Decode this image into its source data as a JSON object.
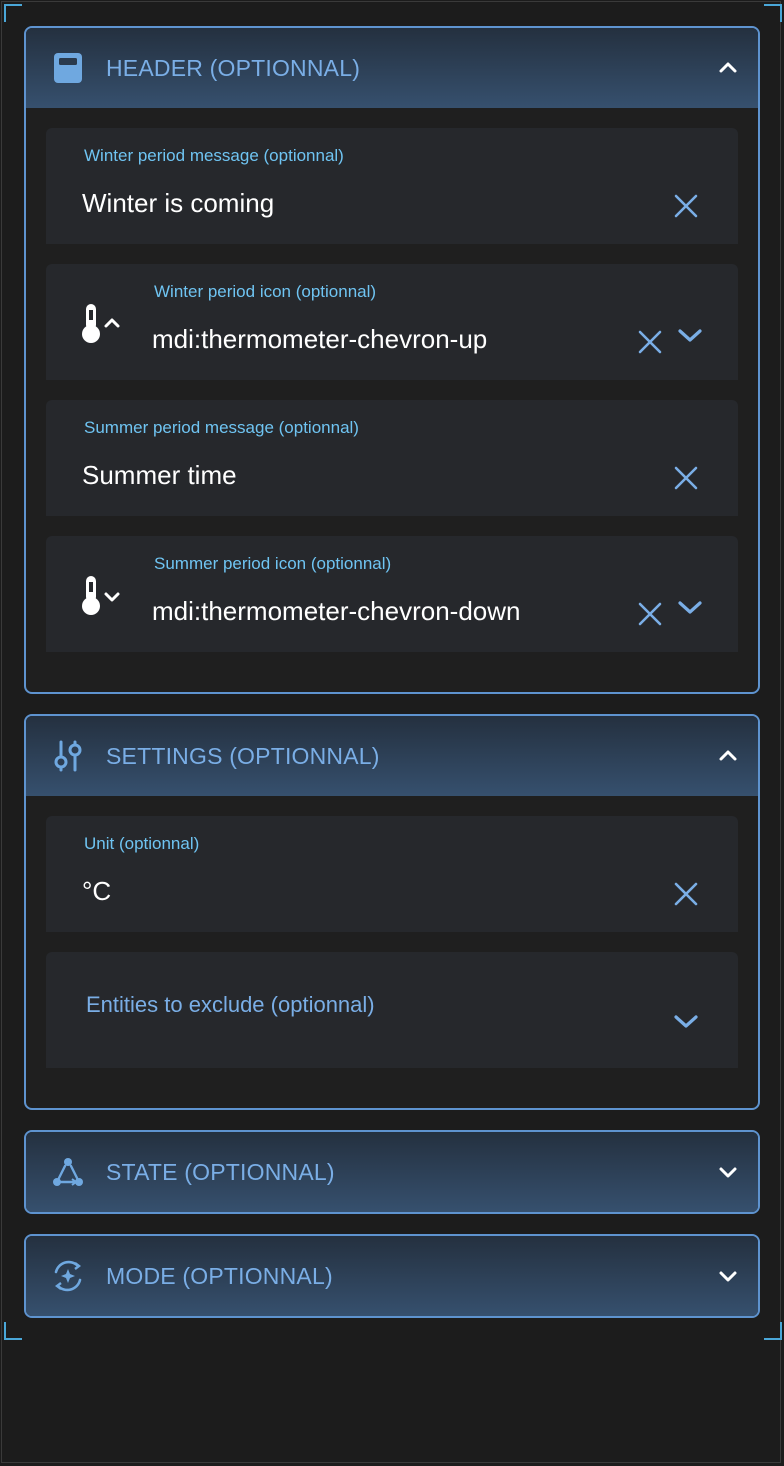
{
  "header_panel": {
    "title": "HEADER (OPTIONNAL)",
    "icon": "calculator-icon",
    "expanded": true,
    "fields": [
      {
        "label": "Winter period message (optionnal)",
        "value": "Winter is coming"
      },
      {
        "label": "Winter period icon (optionnal)",
        "value": "mdi:thermometer-chevron-up",
        "icon": "thermometer-chevron-up-icon"
      },
      {
        "label": "Summer period message (optionnal)",
        "value": "Summer time"
      },
      {
        "label": "Summer period icon (optionnal)",
        "value": "mdi:thermometer-chevron-down",
        "icon": "thermometer-chevron-down-icon"
      }
    ]
  },
  "settings_panel": {
    "title": "SETTINGS (OPTIONNAL)",
    "icon": "tune-icon",
    "expanded": true,
    "unit_field": {
      "label": "Unit (optionnal)",
      "value": "°C"
    },
    "entities_field": {
      "label": "Entities to exclude (optionnal)"
    }
  },
  "state_panel": {
    "title": "STATE (OPTIONNAL)",
    "icon": "state-machine-icon",
    "expanded": false
  },
  "mode_panel": {
    "title": "MODE (OPTIONNAL)",
    "icon": "auto-mode-icon",
    "expanded": false
  },
  "colors": {
    "accent": "#7aaee6",
    "label": "#6fc4f2",
    "border": "#5e93cf",
    "field_bg": "#26282c"
  }
}
